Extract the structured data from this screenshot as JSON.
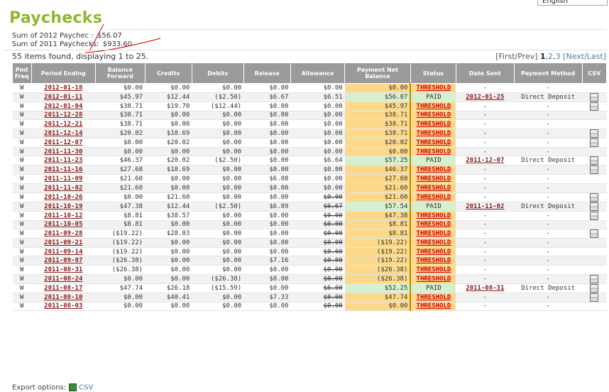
{
  "language": "English",
  "title": "Paychecks",
  "sums": [
    {
      "label": "Sum of 2012 Paychec :",
      "value": "$56.07"
    },
    {
      "label": "Sum of 2011 Paychecks:",
      "value": "$933.60"
    }
  ],
  "found_text": "55 items found, displaying 1 to 25.",
  "pager": {
    "first_prev": "[First/Prev]",
    "current": "1",
    "p2": "2",
    "p3": "3",
    "next_last": "[Next/Last]"
  },
  "columns": [
    "Pmt Freq",
    "Period Ending",
    "Balance Forward",
    "Credits",
    "Debits",
    "Release",
    "Allowance",
    "Payment Net Balance",
    "Status",
    "Date Sent",
    "Payment Method",
    "CSV"
  ],
  "rows": [
    {
      "freq": "W",
      "period": "2012-01-18",
      "bal": "$0.00",
      "credits": "$0.00",
      "debits": "$0.00",
      "release": "$0.00",
      "allow": "$0.00",
      "strike": false,
      "net": "$0.00",
      "status": "THRESHOLD",
      "date": "-",
      "method": "-",
      "csv": false
    },
    {
      "freq": "W",
      "period": "2012-01-11",
      "bal": "$45.97",
      "credits": "$12.44",
      "debits": "($2.50)",
      "release": "$6.67",
      "allow": "$6.51",
      "strike": false,
      "net": "$56.07",
      "status": "PAID",
      "date": "2012-01-25",
      "method": "Direct Deposit",
      "csv": true
    },
    {
      "freq": "W",
      "period": "2012-01-04",
      "bal": "$38.71",
      "credits": "$19.70",
      "debits": "($12.44)",
      "release": "$0.00",
      "allow": "$0.00",
      "strike": false,
      "net": "$45.97",
      "status": "THRESHOLD",
      "date": "-",
      "method": "-",
      "csv": true
    },
    {
      "freq": "W",
      "period": "2011-12-28",
      "bal": "$38.71",
      "credits": "$0.00",
      "debits": "$0.00",
      "release": "$0.00",
      "allow": "$0.00",
      "strike": false,
      "net": "$38.71",
      "status": "THRESHOLD",
      "date": "-",
      "method": "-",
      "csv": false
    },
    {
      "freq": "W",
      "period": "2011-12-21",
      "bal": "$38.71",
      "credits": "$0.00",
      "debits": "$0.00",
      "release": "$0.00",
      "allow": "$0.00",
      "strike": false,
      "net": "$38.71",
      "status": "THRESHOLD",
      "date": "-",
      "method": "-",
      "csv": false
    },
    {
      "freq": "W",
      "period": "2011-12-14",
      "bal": "$20.02",
      "credits": "$18.69",
      "debits": "$0.00",
      "release": "$0.00",
      "allow": "$0.00",
      "strike": false,
      "net": "$38.71",
      "status": "THRESHOLD",
      "date": "-",
      "method": "-",
      "csv": true
    },
    {
      "freq": "W",
      "period": "2011-12-07",
      "bal": "$0.00",
      "credits": "$20.02",
      "debits": "$0.00",
      "release": "$0.00",
      "allow": "$0.00",
      "strike": false,
      "net": "$20.02",
      "status": "THRESHOLD",
      "date": "-",
      "method": "-",
      "csv": true
    },
    {
      "freq": "W",
      "period": "2011-11-30",
      "bal": "$0.00",
      "credits": "$0.00",
      "debits": "$0.00",
      "release": "$0.00",
      "allow": "$0.00",
      "strike": false,
      "net": "$0.00",
      "status": "THRESHOLD",
      "date": "-",
      "method": "-",
      "csv": false
    },
    {
      "freq": "W",
      "period": "2011-11-23",
      "bal": "$46.37",
      "credits": "$20.02",
      "debits": "($2.50)",
      "release": "$0.00",
      "allow": "$6.64",
      "strike": false,
      "net": "$57.25",
      "status": "PAID",
      "date": "2011-12-07",
      "method": "Direct Deposit",
      "csv": true
    },
    {
      "freq": "W",
      "period": "2011-11-16",
      "bal": "$27.68",
      "credits": "$18.69",
      "debits": "$0.00",
      "release": "$0.00",
      "allow": "$0.00",
      "strike": false,
      "net": "$46.37",
      "status": "THRESHOLD",
      "date": "-",
      "method": "-",
      "csv": true
    },
    {
      "freq": "W",
      "period": "2011-11-09",
      "bal": "$21.60",
      "credits": "$0.00",
      "debits": "$0.00",
      "release": "$6.08",
      "allow": "$0.00",
      "strike": false,
      "net": "$27.68",
      "status": "THRESHOLD",
      "date": "-",
      "method": "-",
      "csv": false
    },
    {
      "freq": "W",
      "period": "2011-11-02",
      "bal": "$21.60",
      "credits": "$0.00",
      "debits": "$0.00",
      "release": "$0.00",
      "allow": "$0.00",
      "strike": false,
      "net": "$21.60",
      "status": "THRESHOLD",
      "date": "-",
      "method": "-",
      "csv": false
    },
    {
      "freq": "W",
      "period": "2011-10-26",
      "bal": "$0.00",
      "credits": "$21.60",
      "debits": "$0.00",
      "release": "$0.00",
      "allow": "$0.00",
      "strike": true,
      "net": "$21.60",
      "status": "THRESHOLD",
      "date": "-",
      "method": "-",
      "csv": true
    },
    {
      "freq": "W",
      "period": "2011-10-19",
      "bal": "$47.38",
      "credits": "$12.44",
      "debits": "($2.50)",
      "release": "$6.89",
      "allow": "$6.67",
      "strike": true,
      "net": "$57.54",
      "status": "PAID",
      "date": "2011-11-02",
      "method": "Direct Deposit",
      "csv": true
    },
    {
      "freq": "W",
      "period": "2011-10-12",
      "bal": "$8.81",
      "credits": "$38.57",
      "debits": "$0.00",
      "release": "$0.00",
      "allow": "$0.00",
      "strike": true,
      "net": "$47.38",
      "status": "THRESHOLD",
      "date": "-",
      "method": "-",
      "csv": true
    },
    {
      "freq": "W",
      "period": "2011-10-05",
      "bal": "$8.81",
      "credits": "$0.00",
      "debits": "$0.00",
      "release": "$0.00",
      "allow": "$0.00",
      "strike": true,
      "net": "$8.81",
      "status": "THRESHOLD",
      "date": "-",
      "method": "-",
      "csv": false
    },
    {
      "freq": "W",
      "period": "2011-09-28",
      "bal": "($19.22)",
      "credits": "$28.03",
      "debits": "$0.00",
      "release": "$0.00",
      "allow": "$0.00",
      "strike": true,
      "net": "$8.81",
      "status": "THRESHOLD",
      "date": "-",
      "method": "-",
      "csv": true
    },
    {
      "freq": "W",
      "period": "2011-09-21",
      "bal": "($19.22)",
      "credits": "$0.00",
      "debits": "$0.00",
      "release": "$0.00",
      "allow": "$0.00",
      "strike": true,
      "net": "($19.22)",
      "status": "THRESHOLD",
      "date": "-",
      "method": "-",
      "csv": false
    },
    {
      "freq": "W",
      "period": "2011-09-14",
      "bal": "($19.22)",
      "credits": "$0.00",
      "debits": "$0.00",
      "release": "$0.00",
      "allow": "$0.00",
      "strike": true,
      "net": "($19.22)",
      "status": "THRESHOLD",
      "date": "-",
      "method": "-",
      "csv": false
    },
    {
      "freq": "W",
      "period": "2011-09-07",
      "bal": "($26.38)",
      "credits": "$0.00",
      "debits": "$0.00",
      "release": "$7.16",
      "allow": "$0.00",
      "strike": true,
      "net": "($19.22)",
      "status": "THRESHOLD",
      "date": "-",
      "method": "-",
      "csv": false
    },
    {
      "freq": "W",
      "period": "2011-08-31",
      "bal": "($26.38)",
      "credits": "$0.00",
      "debits": "$0.00",
      "release": "$0.00",
      "allow": "$0.00",
      "strike": true,
      "net": "($26.38)",
      "status": "THRESHOLD",
      "date": "-",
      "method": "-",
      "csv": false
    },
    {
      "freq": "W",
      "period": "2011-08-24",
      "bal": "$0.00",
      "credits": "$0.00",
      "debits": "($26.38)",
      "release": "$0.00",
      "allow": "$0.00",
      "strike": true,
      "net": "($26.38)",
      "status": "THRESHOLD",
      "date": "-",
      "method": "-",
      "csv": true
    },
    {
      "freq": "W",
      "period": "2011-08-17",
      "bal": "$47.74",
      "credits": "$26.18",
      "debits": "($15.59)",
      "release": "$0.00",
      "allow": "$6.00",
      "strike": true,
      "net": "$52.25",
      "status": "PAID",
      "date": "2011-08-31",
      "method": "Direct Deposit",
      "csv": true
    },
    {
      "freq": "W",
      "period": "2011-08-10",
      "bal": "$0.00",
      "credits": "$40.41",
      "debits": "$0.00",
      "release": "$7.33",
      "allow": "$0.00",
      "strike": true,
      "net": "$47.74",
      "status": "THRESHOLD",
      "date": "-",
      "method": "-",
      "csv": true
    },
    {
      "freq": "W",
      "period": "2011-08-03",
      "bal": "$0.00",
      "credits": "$0.00",
      "debits": "$0.00",
      "release": "$0.00",
      "allow": "$0.00",
      "strike": true,
      "net": "$0.00",
      "status": "THRESHOLD",
      "date": "-",
      "method": "-",
      "csv": false
    }
  ],
  "export": {
    "label": "Export options:",
    "csv": "CSV"
  }
}
